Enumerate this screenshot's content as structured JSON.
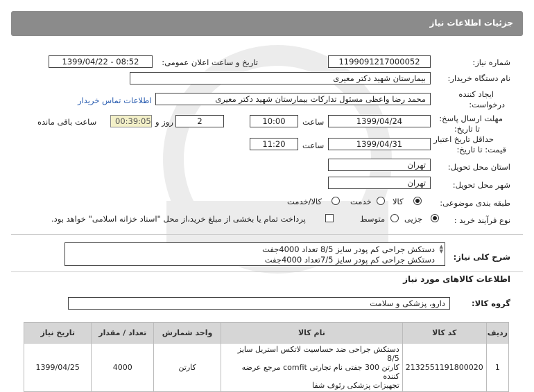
{
  "header": {
    "title": "جزئیات اطلاعات نیاز"
  },
  "form": {
    "need_number_label": "شماره نیاز:",
    "need_number": "1199091217000052",
    "announce_label": "تاریخ و ساعت اعلان عمومی:",
    "announce_value": "1399/04/22 - 08:52",
    "buyer_label": "نام دستگاه خریدار:",
    "buyer_value": "بیمارستان شهید دکتر معیری",
    "creator_label_1": "ایجاد کننده",
    "creator_label_2": "درخواست:",
    "creator_value": "محمد رضا  واعظی  مسئول تدارکات بیمارستان شهید دکتر معیری",
    "contact_link": "اطلاعات تماس خریدار",
    "deadline_label_1": "مهلت ارسال پاسخ:",
    "deadline_label_2": "تا تاریخ:",
    "deadline_date": "1399/04/24",
    "time_label": "ساعت",
    "deadline_time": "10:00",
    "days_value": "2",
    "days_label": "روز و",
    "timer_value": "00:39:05",
    "remaining_label": "ساعت باقی مانده",
    "validity_label_1": "حداقل تاریخ اعتبار",
    "validity_label_2": "قیمت: تا تاریخ:",
    "validity_date": "1399/04/31",
    "validity_time": "11:20",
    "province_label": "استان محل تحویل:",
    "province_value": "تهران",
    "city_label": "شهر محل تحویل:",
    "city_value": "تهران",
    "category_label": "طبقه بندی موضوعی:",
    "category_options": [
      "کالا",
      "خدمت",
      "کالا/خدمت"
    ],
    "purchase_label": "نوع فرآیند خرید :",
    "purchase_options": [
      "جزیی",
      "متوسط"
    ],
    "payment_note": "پرداخت تمام یا بخشی از مبلغ خرید،از محل \"اسناد خزانه اسلامی\" خواهد بود."
  },
  "summary": {
    "label": "شرح کلی نیاز:",
    "lines": [
      "دستکش جراحی کم پودر سایز 8/5 تعداد 4000جفت",
      "دستکش جراحی کم پودر سایز 7/5تعداد 4000جفت"
    ]
  },
  "goods": {
    "title": "اطلاعات کالاهای مورد نیاز",
    "group_label": "گروه کالا:",
    "group_value": "دارو، پزشکی و سلامت"
  },
  "table": {
    "headers": [
      "ردیف",
      "کد کالا",
      "نام کالا",
      "واحد شمارش",
      "تعداد / مقدار",
      "تاریخ نیاز"
    ],
    "rows": [
      {
        "row": "1",
        "code": "2132551191800020",
        "name_lines": [
          "دستکش جراحی ضد حساسیت لاتکس استریل سایز 8/5",
          "کارتن 300 جفتی نام تجارتی comfit مرجع عرضه کننده",
          "تجهیزات پزشکی رئوف شفا"
        ],
        "unit": "کارتن",
        "qty": "4000",
        "date": "1399/04/25"
      }
    ]
  },
  "colors": {
    "header_bg": "#8b8b8b",
    "timer_bg": "#f3f0c8",
    "link": "#2a5db0",
    "table_head": "#d6d6d6"
  }
}
